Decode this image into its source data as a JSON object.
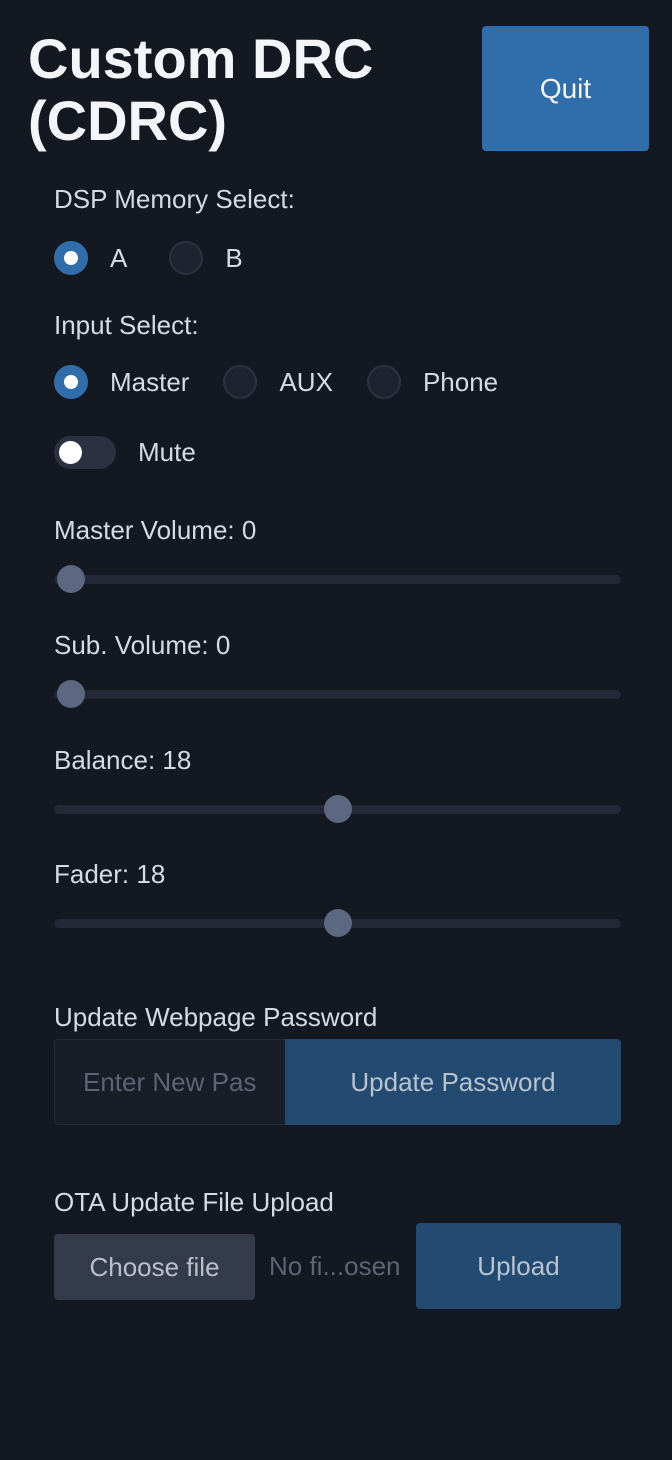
{
  "header": {
    "title": "Custom DRC (CDRC)",
    "quit_label": "Quit"
  },
  "dsp_memory": {
    "label": "DSP Memory Select:",
    "options": [
      {
        "label": "A",
        "checked": true
      },
      {
        "label": "B",
        "checked": false
      }
    ]
  },
  "input_select": {
    "label": "Input Select:",
    "options": [
      {
        "label": "Master",
        "checked": true
      },
      {
        "label": "AUX",
        "checked": false
      },
      {
        "label": "Phone",
        "checked": false
      }
    ]
  },
  "mute": {
    "label": "Mute",
    "on": false
  },
  "sliders": [
    {
      "label": "Master Volume: 0",
      "fraction": 0.0
    },
    {
      "label": "Sub. Volume: 0",
      "fraction": 0.0
    },
    {
      "label": "Balance: 18",
      "fraction": 0.5
    },
    {
      "label": "Fader: 18",
      "fraction": 0.5
    }
  ],
  "password": {
    "label": "Update Webpage Password",
    "placeholder": "Enter New Password",
    "button_label": "Update Password"
  },
  "ota": {
    "label": "OTA Update File Upload",
    "choose_label": "Choose file",
    "file_status": "No fi...osen",
    "upload_label": "Upload"
  },
  "colors": {
    "background": "#141821",
    "accent": "#2f6eab",
    "button_dark": "#234a70"
  }
}
